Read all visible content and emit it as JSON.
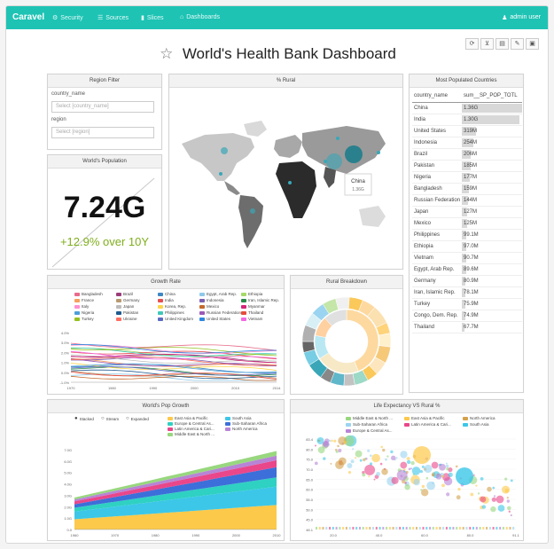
{
  "nav": {
    "brand": "Caravel",
    "items": [
      {
        "label": "Security",
        "icon": "shield-icon",
        "glyph": "⚙"
      },
      {
        "label": "Sources",
        "icon": "database-icon",
        "glyph": "☰"
      },
      {
        "label": "Slices",
        "icon": "bar-chart-icon",
        "glyph": "▮"
      },
      {
        "label": "Dashboards",
        "icon": "dashboard-icon",
        "glyph": "⌂"
      }
    ],
    "user": "admin user"
  },
  "dashboard": {
    "title": "World's Health Bank Dashboard",
    "toolbar_icons": [
      "refresh-icon",
      "filter-icon",
      "css-icon",
      "edit-icon",
      "save-icon"
    ]
  },
  "region_filter": {
    "title": "Region Filter",
    "country_label": "country_name",
    "country_placeholder": "Select [country_name]",
    "region_label": "region",
    "region_placeholder": "Select [region]"
  },
  "world_population": {
    "title": "World's Population",
    "value": "7.24G",
    "change": "+12.9% over 10Y"
  },
  "rural_map": {
    "title": "% Rural",
    "tooltip_country": "China",
    "tooltip_value": "1.36G"
  },
  "populated_countries": {
    "title": "Most Populated Countries",
    "columns": [
      "country_name",
      "sum__SP_POP_TOTL"
    ],
    "rows": [
      {
        "name": "China",
        "value": "1.36G",
        "fraction": 1.0
      },
      {
        "name": "India",
        "value": "1.30G",
        "fraction": 0.95
      },
      {
        "name": "United States",
        "value": "319M",
        "fraction": 0.24
      },
      {
        "name": "Indonesia",
        "value": "254M",
        "fraction": 0.19
      },
      {
        "name": "Brazil",
        "value": "206M",
        "fraction": 0.15
      },
      {
        "name": "Pakistan",
        "value": "185M",
        "fraction": 0.14
      },
      {
        "name": "Nigeria",
        "value": "177M",
        "fraction": 0.13
      },
      {
        "name": "Bangladesh",
        "value": "159M",
        "fraction": 0.12
      },
      {
        "name": "Russian Federation",
        "value": "144M",
        "fraction": 0.11
      },
      {
        "name": "Japan",
        "value": "127M",
        "fraction": 0.09
      },
      {
        "name": "Mexico",
        "value": "125M",
        "fraction": 0.09
      },
      {
        "name": "Philippines",
        "value": "99.1M",
        "fraction": 0.07
      },
      {
        "name": "Ethiopia",
        "value": "97.0M",
        "fraction": 0.07
      },
      {
        "name": "Vietnam",
        "value": "90.7M",
        "fraction": 0.07
      },
      {
        "name": "Egypt, Arab Rep.",
        "value": "89.6M",
        "fraction": 0.07
      },
      {
        "name": "Germany",
        "value": "80.9M",
        "fraction": 0.06
      },
      {
        "name": "Iran, Islamic Rep.",
        "value": "78.1M",
        "fraction": 0.06
      },
      {
        "name": "Turkey",
        "value": "75.9M",
        "fraction": 0.06
      },
      {
        "name": "Congo, Dem. Rep.",
        "value": "74.9M",
        "fraction": 0.06
      },
      {
        "name": "Thailand",
        "value": "67.7M",
        "fraction": 0.05
      }
    ]
  },
  "growth_rate": {
    "title": "Growth Rate",
    "legend": [
      {
        "name": "Bangladesh",
        "color": "#e86b8a"
      },
      {
        "name": "Brazil",
        "color": "#9c3d7a"
      },
      {
        "name": "China",
        "color": "#3d87c4"
      },
      {
        "name": "Egypt, Arab Rep.",
        "color": "#8ec9e8"
      },
      {
        "name": "Ethiopia",
        "color": "#a6d96a"
      },
      {
        "name": "France",
        "color": "#f6a05d"
      },
      {
        "name": "Germany",
        "color": "#b89a70"
      },
      {
        "name": "India",
        "color": "#e65050"
      },
      {
        "name": "Indonesia",
        "color": "#7b60b2"
      },
      {
        "name": "Iran, Islamic Rep.",
        "color": "#2b8a4c"
      },
      {
        "name": "Italy",
        "color": "#ff8fd0"
      },
      {
        "name": "Japan",
        "color": "#bcbcbc"
      },
      {
        "name": "Korea, Rep.",
        "color": "#ffd54a"
      },
      {
        "name": "Mexico",
        "color": "#c46a2c"
      },
      {
        "name": "Myanmar",
        "color": "#d4247a"
      },
      {
        "name": "Nigeria",
        "color": "#4d9ed9"
      },
      {
        "name": "Pakistan",
        "color": "#1f5a8f"
      },
      {
        "name": "Philippines",
        "color": "#40c8b8"
      },
      {
        "name": "Russian Federation",
        "color": "#9b59b6"
      },
      {
        "name": "Thailand",
        "color": "#e74c3c"
      },
      {
        "name": "Turkey",
        "color": "#95c11f"
      },
      {
        "name": "Ukraine",
        "color": "#ff6f61"
      },
      {
        "name": "United Kingdom",
        "color": "#5c6bc0"
      },
      {
        "name": "United States",
        "color": "#2e86de"
      },
      {
        "name": "Vietnam",
        "color": "#f368e0"
      }
    ],
    "x_ticks": [
      "1970",
      "1980",
      "1990",
      "2000",
      "2010",
      "2014"
    ],
    "y_ticks": [
      "4.0%",
      "3.0%",
      "2.0%",
      "1.0%",
      "0.0%",
      "-1.0%"
    ]
  },
  "rural_breakdown": {
    "title": "Rural Breakdown"
  },
  "pop_growth": {
    "title": "World's Pop Growth",
    "modes": [
      "Stacked",
      "Stream",
      "Expanded"
    ],
    "legend": [
      {
        "name": "East Asia & Pacific",
        "color": "#fdc94a"
      },
      {
        "name": "South Asia",
        "color": "#3cc7e8"
      },
      {
        "name": "Europe & Central As...",
        "color": "#2fd1c2"
      },
      {
        "name": "Sub-Saharan Africa",
        "color": "#3c6fd9"
      },
      {
        "name": "Latin America & Cari...",
        "color": "#e9478a"
      },
      {
        "name": "North America",
        "color": "#b784d6"
      },
      {
        "name": "Middle East & North ...",
        "color": "#98d77e"
      }
    ],
    "x_ticks": [
      "1960",
      "1970",
      "1980",
      "1990",
      "2000",
      "2010"
    ],
    "y_ticks": [
      "7.0G",
      "6.0G",
      "5.0G",
      "4.0G",
      "3.0G",
      "2.0G",
      "1.0G",
      "0.0"
    ]
  },
  "life_expectancy": {
    "title": "Life Expectancy VS Rural %",
    "legend": [
      {
        "name": "Middle East & North ...",
        "color": "#98d77e"
      },
      {
        "name": "East Asia & Pacific",
        "color": "#fdc94a"
      },
      {
        "name": "North America",
        "color": "#d4a24b"
      },
      {
        "name": "Sub-Saharan Africa",
        "color": "#9ad4f0"
      },
      {
        "name": "Latin America & Cari...",
        "color": "#e9478a"
      },
      {
        "name": "South Asia",
        "color": "#3cc7e8"
      },
      {
        "name": "Europe & Central As...",
        "color": "#b784d6"
      }
    ],
    "x_ticks": [
      "20.0",
      "40.0",
      "60.0",
      "80.0",
      "91.1"
    ],
    "y_ticks": [
      "83.4",
      "80.0",
      "75.0",
      "70.0",
      "65.0",
      "60.0",
      "55.0",
      "50.0",
      "45.0",
      "48.1"
    ]
  }
}
